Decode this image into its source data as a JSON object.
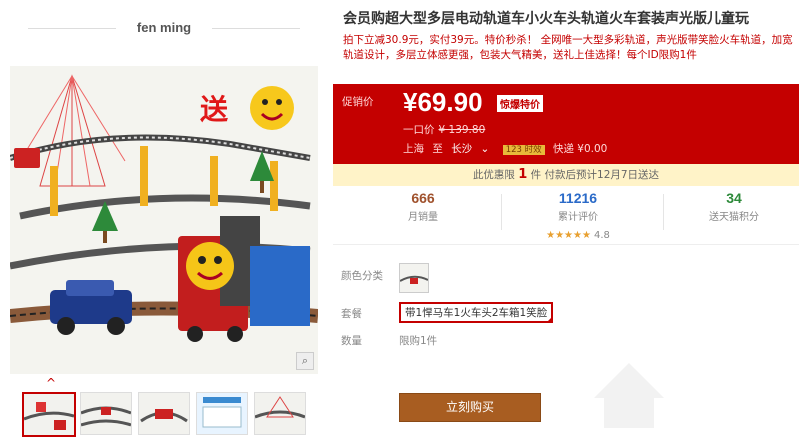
{
  "brand": {
    "name": "fen ming"
  },
  "gallery": {
    "badge_text": "送",
    "zoom_icon": "magnifier-icon",
    "thumb_count": 5
  },
  "product": {
    "title": "会员购超大型多层电动轨道车小火车头轨道火车套装声光版儿童玩",
    "subtitle": "拍下立减30.9元，实付39元。特价秒杀！ 全网唯一大型多彩轨道，声光版带笑脸火车轨道，加宽轨道设计，多层立体感更强，包装大气精美，送礼上佳选择！每个ID限购1件"
  },
  "price": {
    "label": "促销价",
    "current": "¥69.90",
    "promo_tag": "惊爆特价",
    "orig_label": "一口价",
    "orig_value": "¥ 139.80",
    "from": "上海",
    "to_word": "至",
    "destination": "长沙",
    "time_badge": "123 时效",
    "shipping": "快递 ¥0.00"
  },
  "limit": {
    "prefix": "此优惠限",
    "count": "1",
    "suffix": "件  付款后预计12月7日送达"
  },
  "stats": {
    "monthly_sales": {
      "value": "666",
      "label": "月销量"
    },
    "reviews": {
      "value": "11216",
      "label": "累计评价",
      "stars": "★★★★★",
      "rating": "4.8"
    },
    "points": {
      "value": "34",
      "label": "送天猫积分"
    }
  },
  "sku": {
    "color_label": "颜色分类",
    "set_label": "套餐",
    "set_option": "带1悍马车1火车头2车箱1笑脸",
    "qty_label": "数量",
    "qty_value": "限购1件"
  },
  "buy": {
    "label": "立刻购买"
  },
  "colors": {
    "accent": "#c40000",
    "buy_button": "#a85d21",
    "promo_bg": "#fff3c8"
  }
}
